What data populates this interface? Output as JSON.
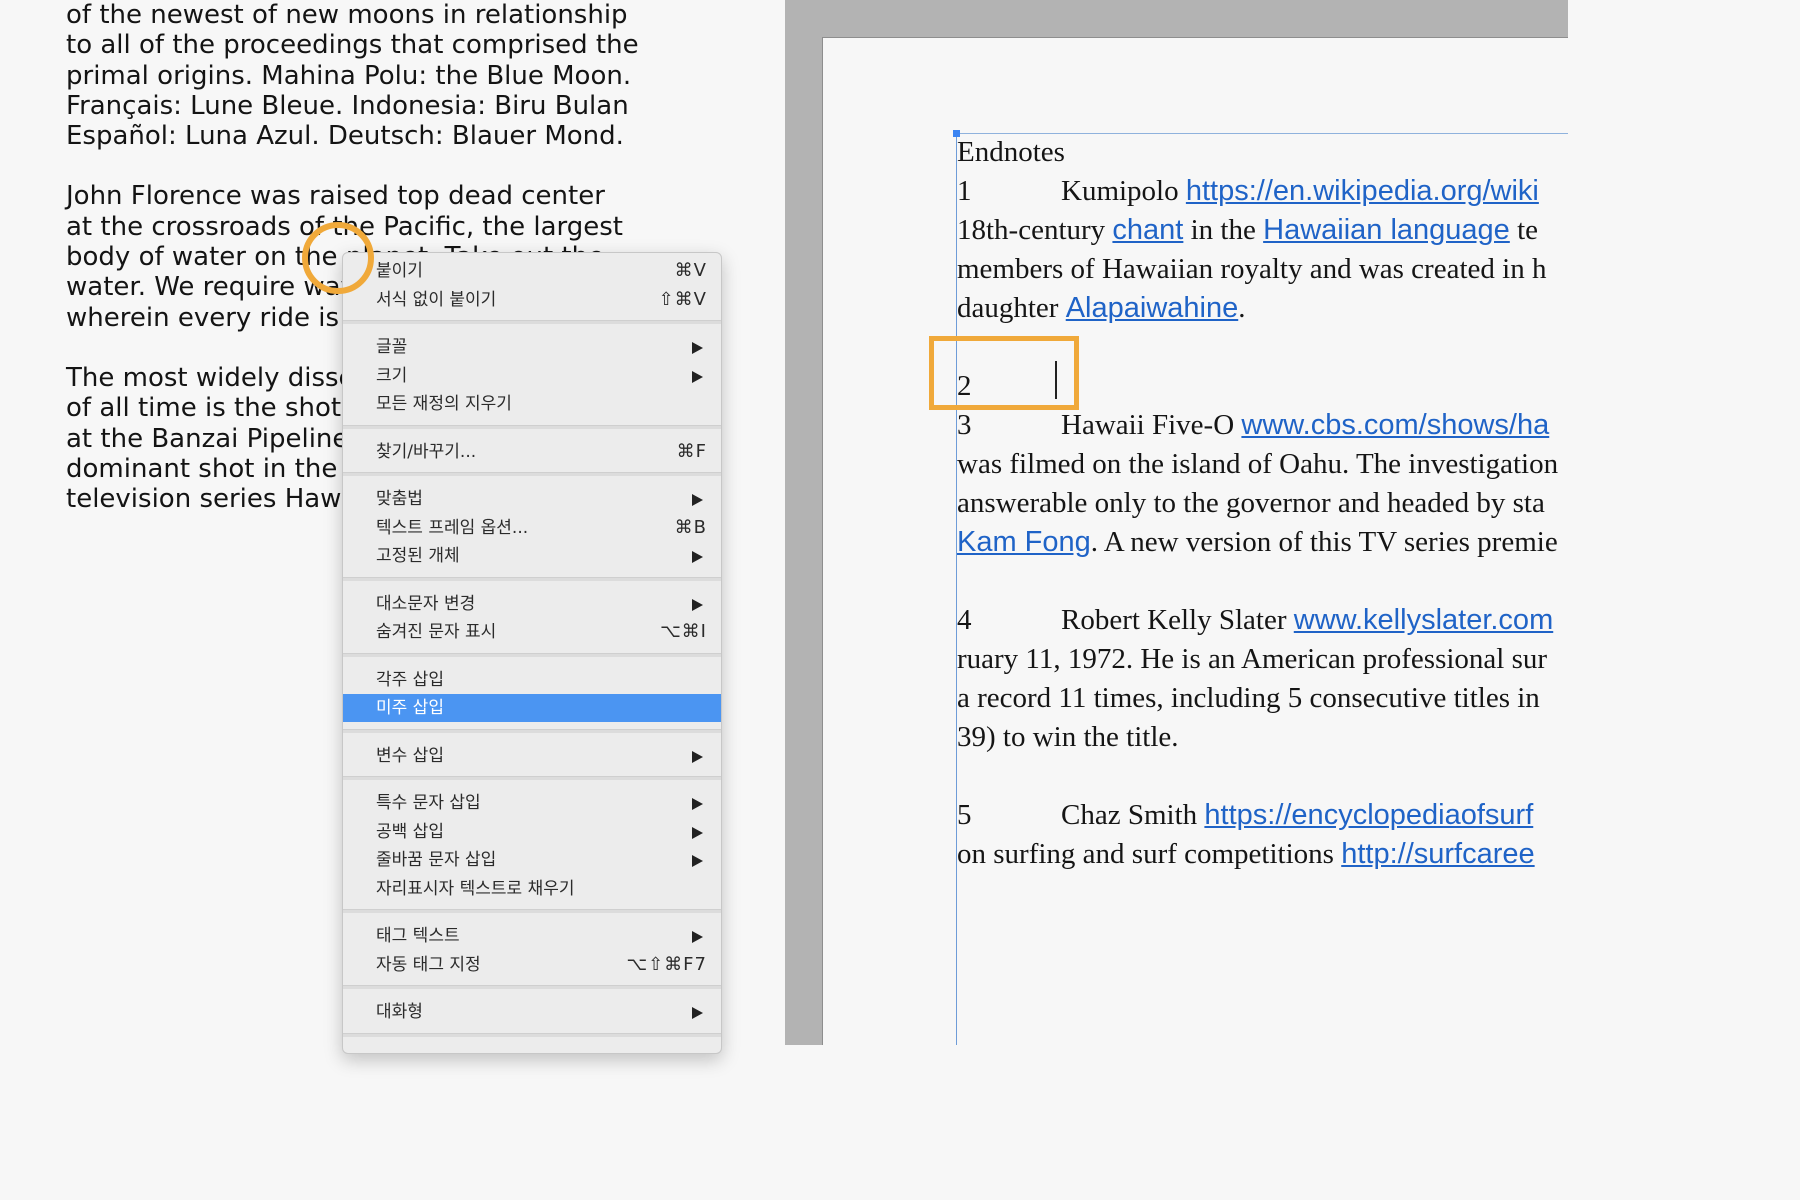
{
  "story": {
    "paragraphs": [
      [
        "of the newest of new moons in relationship",
        "to all of the proceedings that comprised the",
        "primal origins. Mahina Polu: the Blue Moon.",
        "Français: Lune Bleue. Indonesia: Biru Bulan",
        "Español: Luna Azul. Deutsch: Blauer Mond."
      ],
      [
        "John Florence was raised top dead center",
        "at the crossroads of the Pacific, the largest",
        "body of water on the planet. Take out the",
        "water. We require waves",
        "wherein every ride is a"
      ],
      [
        "The most widely disse",
        "of all time is the shot c",
        "at the Banzai Pipeline,",
        "dominant shot in the c",
        "television series Hawa"
      ]
    ]
  },
  "endnotes": {
    "heading": "Endnotes",
    "notes": [
      {
        "num": "1",
        "lines": [
          [
            {
              "t": "Kumipolo "
            },
            {
              "t": "https://en.wikipedia.org/wiki",
              "link": true
            }
          ],
          [
            {
              "t": "18th-century "
            },
            {
              "t": "chant",
              "link": true
            },
            {
              "t": " in the "
            },
            {
              "t": "Hawaiian language",
              "link": true
            },
            {
              "t": " te"
            }
          ],
          [
            {
              "t": "members of Hawaiian royalty and was created in h"
            }
          ],
          [
            {
              "t": "daughter "
            },
            {
              "t": "Alapaiwahine",
              "link": true
            },
            {
              "t": "."
            }
          ]
        ]
      },
      {
        "num": "2",
        "lines": [
          [
            {
              "t": ""
            }
          ]
        ]
      },
      {
        "num": "3",
        "lines": [
          [
            {
              "t": "Hawaii Five-O "
            },
            {
              "t": "www.cbs.com/shows/ha",
              "link": true
            }
          ],
          [
            {
              "t": "was filmed on the island of Oahu. The investigation"
            }
          ],
          [
            {
              "t": "answerable only to the governor and headed by sta"
            }
          ],
          [
            {
              "t": "Kam Fong",
              "link": true
            },
            {
              "t": ". A new version of this TV series premie"
            }
          ]
        ]
      },
      {
        "num": "4",
        "lines": [
          [
            {
              "t": "Robert Kelly Slater "
            },
            {
              "t": "www.kellyslater.com",
              "link": true
            }
          ],
          [
            {
              "t": "ruary 11, 1972. He is an American professional sur"
            }
          ],
          [
            {
              "t": "a record 11 times, including 5 consecutive titles in"
            }
          ],
          [
            {
              "t": "39) to win the title."
            }
          ]
        ]
      },
      {
        "num": "5",
        "lines": [
          [
            {
              "t": "Chaz Smith "
            },
            {
              "t": "https://encyclopediaofsurf",
              "link": true
            }
          ],
          [
            {
              "t": "on surfing and surf competitions "
            },
            {
              "t": "http://surfcaree",
              "link": true
            }
          ]
        ]
      }
    ]
  },
  "context_menu": {
    "items": [
      {
        "label": "붙이기",
        "shortcut": "⌘V"
      },
      {
        "label": "서식 없이 붙이기",
        "shortcut": "⇧⌘V"
      },
      {
        "sep": true
      },
      {
        "label": "글꼴",
        "submenu": true
      },
      {
        "label": "크기",
        "submenu": true
      },
      {
        "label": "모든 재정의 지우기"
      },
      {
        "sep": true
      },
      {
        "label": "찾기/바꾸기...",
        "shortcut": "⌘F"
      },
      {
        "sep": true
      },
      {
        "label": "맞춤법",
        "submenu": true
      },
      {
        "label": "텍스트 프레임 옵션...",
        "shortcut": "⌘B"
      },
      {
        "label": "고정된 개체",
        "submenu": true
      },
      {
        "sep": true
      },
      {
        "label": "대소문자 변경",
        "submenu": true
      },
      {
        "label": "숨겨진 문자 표시",
        "shortcut": "⌥⌘I"
      },
      {
        "sep": true
      },
      {
        "label": "각주 삽입"
      },
      {
        "label": "미주 삽입",
        "selected": true
      },
      {
        "sep": true
      },
      {
        "label": "변수 삽입",
        "submenu": true
      },
      {
        "sep": true
      },
      {
        "label": "특수 문자 삽입",
        "submenu": true
      },
      {
        "label": "공백 삽입",
        "submenu": true
      },
      {
        "label": "줄바꿈 문자 삽입",
        "submenu": true
      },
      {
        "label": "자리표시자 텍스트로 채우기"
      },
      {
        "sep": true
      },
      {
        "label": "태그 텍스트",
        "submenu": true
      },
      {
        "label": "자동 태그 지정",
        "shortcut": "⌥⇧⌘F7"
      },
      {
        "sep": true
      },
      {
        "label": "대화형",
        "submenu": true
      },
      {
        "sep": true
      }
    ]
  },
  "colors": {
    "link": "#1f63c7",
    "highlight": "#f0a93a",
    "menu_selected": "#4b95f2"
  }
}
